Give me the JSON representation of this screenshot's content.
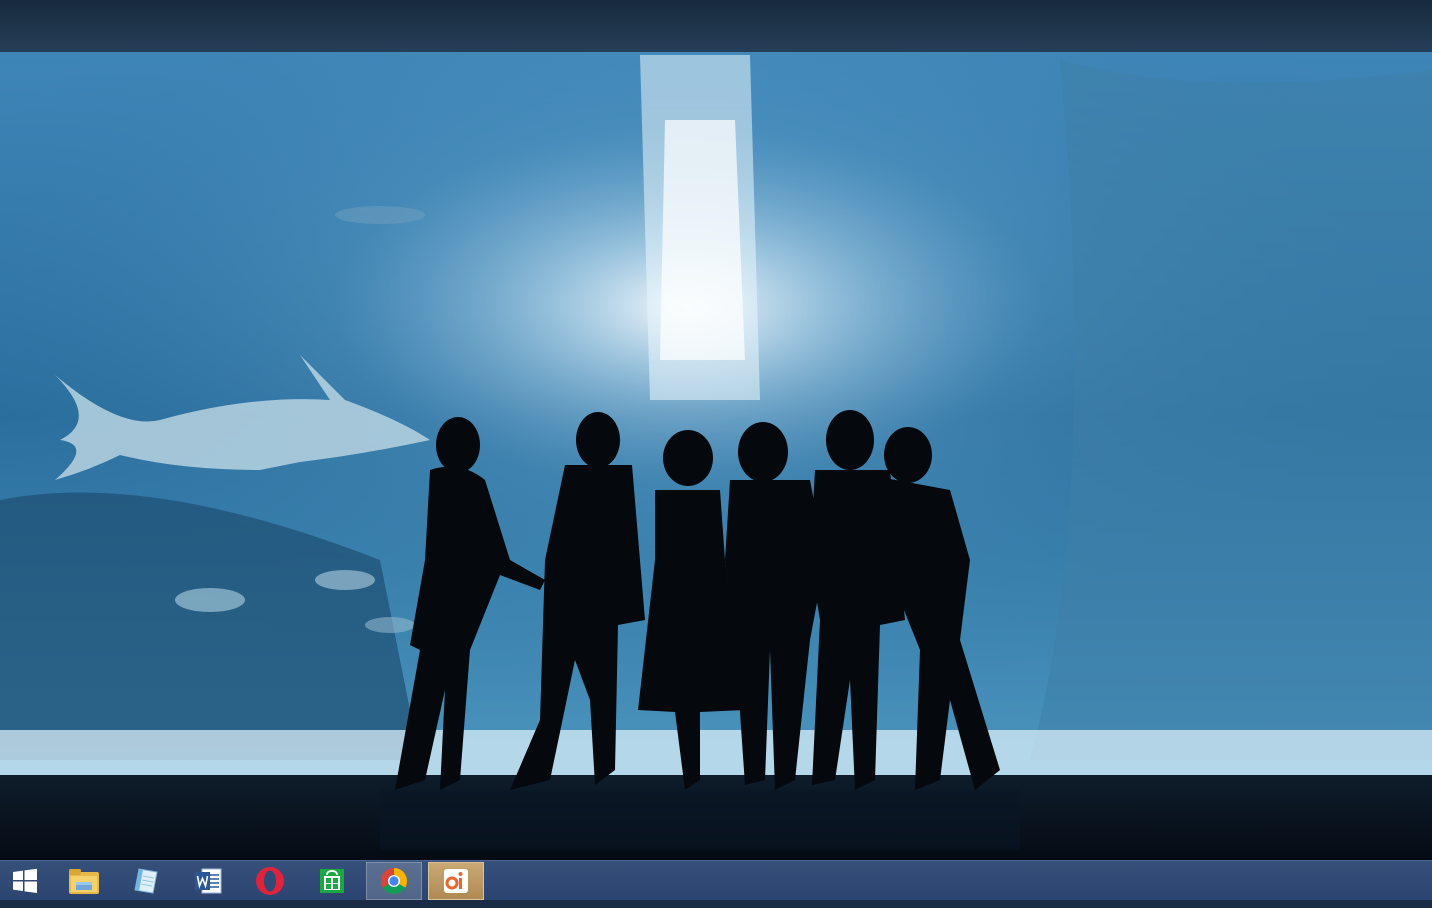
{
  "desktop": {
    "wallpaper": "aquarium-silhouette-wallpaper"
  },
  "taskbar": {
    "color": "#2f4a76",
    "items": [
      {
        "name": "start-button",
        "icon": "windows-logo-icon"
      },
      {
        "name": "file-explorer",
        "icon": "folder-icon"
      },
      {
        "name": "notepad",
        "icon": "notepad-icon"
      },
      {
        "name": "microsoft-word",
        "icon": "word-icon"
      },
      {
        "name": "opera-browser",
        "icon": "opera-icon"
      },
      {
        "name": "windows-store",
        "icon": "store-icon"
      },
      {
        "name": "google-chrome",
        "icon": "chrome-icon",
        "state": "active"
      },
      {
        "name": "photo-app",
        "icon": "photo-app-icon",
        "state": "running"
      }
    ]
  }
}
